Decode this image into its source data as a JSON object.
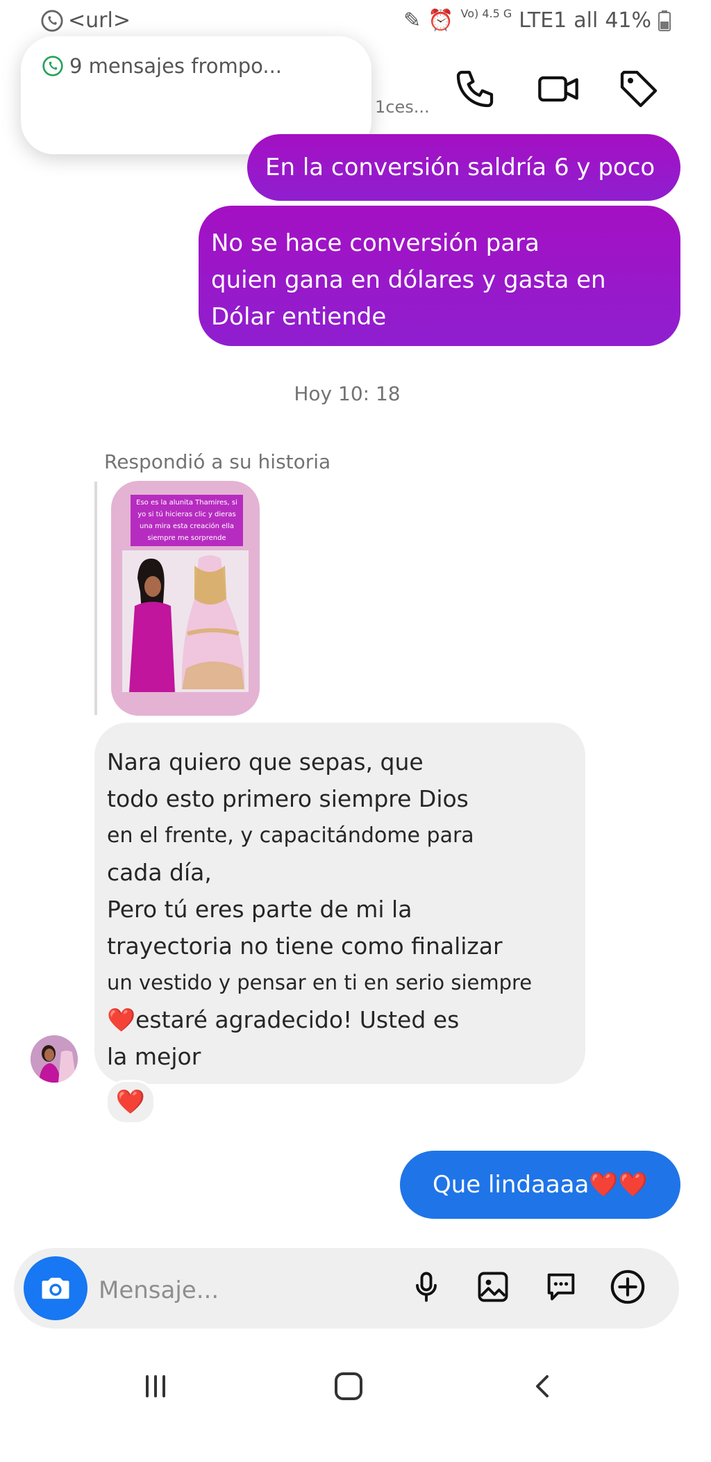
{
  "status_bar": {
    "notif_url": "<url>",
    "network": "Vo) 4.5 G",
    "lte": "LTE1",
    "signal": "all",
    "battery": "41%"
  },
  "notification": {
    "text": "9 mensajes frompo..."
  },
  "header": {
    "subtitle": "1ces..."
  },
  "messages": {
    "out1": "En la conversión saldría 6 y poco",
    "out2_lines": [
      "No se hace conversión para",
      " quien gana en dólares y gasta en",
      " Dólar entiende"
    ],
    "timestamp": "Hoy 10: 18",
    "reply_label": "Respondió a su historia",
    "story_caption": "Eso es la alunita Thamires, si yo si tú hicieras clic y dieras una mira esta creación ella siempre me sorprende",
    "incoming_lines": [
      " Nara quiero que sepas, que",
      "todo esto primero siempre Dios",
      " en el frente, y capacitándome para",
      "cada día,",
      " Pero tú eres parte de mi la",
      "trayectoria no tiene como finalizar",
      "un vestido y pensar en ti en serio siempre",
      "❤️estaré agradecido! Usted es",
      "la mejor"
    ],
    "reaction": "❤️",
    "out3": "Que lindaaaa❤️❤️"
  },
  "composer": {
    "placeholder": "Mensaje...",
    "icons": [
      "camera-icon",
      "microphone-icon",
      "gallery-icon",
      "sticker-icon",
      "plus-icon"
    ]
  },
  "colors": {
    "outgoing_purple": "#9b15c8",
    "outgoing_blue": "#1f74e8",
    "incoming_grey": "#efefef",
    "camera_blue": "#1877f2"
  }
}
